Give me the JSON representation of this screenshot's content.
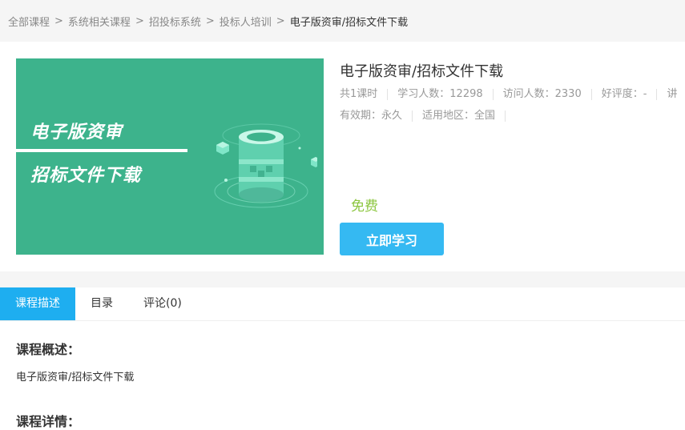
{
  "breadcrumb": {
    "items": [
      "全部课程",
      "系统相关课程",
      "招投标系统",
      "投标人培训"
    ],
    "current": "电子版资审/招标文件下载",
    "separator": ">"
  },
  "cover": {
    "line1": "电子版资审",
    "line2": "招标文件下载",
    "bg_color": "#3db38c"
  },
  "course": {
    "title": "电子版资审/招标文件下载",
    "stats": [
      "共1课时",
      "学习人数：12298",
      "访问人数：2330",
      "好评度：-",
      "讲"
    ],
    "meta": [
      "有效期：永久",
      "适用地区：全国"
    ],
    "price": "免费",
    "cta": "立即学习"
  },
  "tabs": [
    {
      "label": "课程描述",
      "active": true
    },
    {
      "label": "目录",
      "active": false
    },
    {
      "label": "评论(0)",
      "active": false
    }
  ],
  "description": {
    "overview_title": "课程概述：",
    "overview_text": "电子版资审/招标文件下载",
    "detail_title": "课程详情："
  },
  "colors": {
    "accent": "#1eaef0",
    "button": "#35b9f2",
    "price": "#8cc63f"
  }
}
